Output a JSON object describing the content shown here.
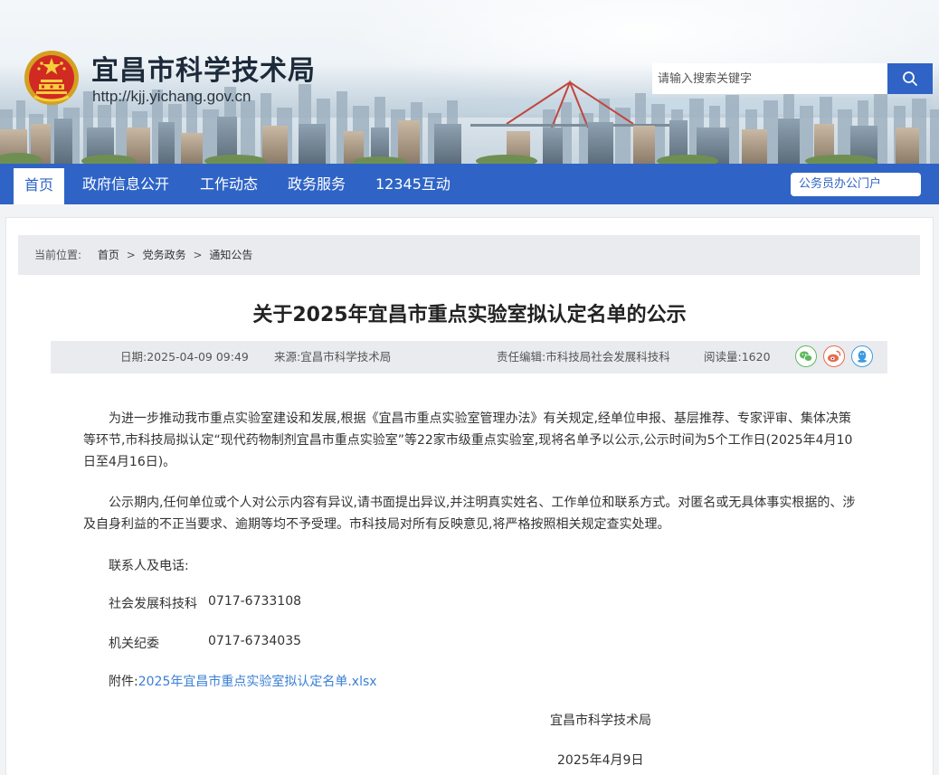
{
  "header": {
    "site_title": "宜昌市科学技术局",
    "site_url": "http://kjj.yichang.gov.cn",
    "search_placeholder": "请输入搜索关键字"
  },
  "nav": {
    "items": [
      "首页",
      "政府信息公开",
      "工作动态",
      "政务服务",
      "12345互动"
    ],
    "active": "首页",
    "portal_label": "公务员办公门户"
  },
  "breadcrumb": {
    "label": "当前位置:",
    "items": [
      "首页",
      "党务政务",
      "通知公告"
    ],
    "sep": ">"
  },
  "article": {
    "title": "关于2025年宜昌市重点实验室拟认定名单的公示",
    "meta": {
      "date": "日期:2025-04-09 09:49",
      "source": "来源:宜昌市科学技术局",
      "editor": "责任编辑:市科技局社会发展科技科",
      "views": "阅读量:1620"
    },
    "share_icons": [
      "wechat-icon",
      "weibo-icon",
      "qq-icon"
    ],
    "paragraphs": [
      "为进一步推动我市重点实验室建设和发展,根据《宜昌市重点实验室管理办法》有关规定,经单位申报、基层推荐、专家评审、集体决策等环节,市科技局拟认定“现代药物制剂宜昌市重点实验室”等22家市级重点实验室,现将名单予以公示,公示时间为5个工作日(2025年4月10日至4月16日)。",
      "公示期内,任何单位或个人对公示内容有异议,请书面提出异议,并注明真实姓名、工作单位和联系方式。对匿名或无具体事实根据的、涉及自身利益的不正当要求、逾期等均不予受理。市科技局对所有反映意见,将严格按照相关规定查实处理。"
    ],
    "contact_label": "联系人及电话:",
    "contacts": [
      {
        "name": "社会发展科技科",
        "phone": "0717-6733108"
      },
      {
        "name": "机关纪委",
        "phone": "0717-6734035"
      }
    ],
    "attachment_label": "附件:",
    "attachment_link": "2025年宜昌市重点实验室拟认定名单.xlsx",
    "signature": "宜昌市科学技术局",
    "sign_date": "2025年4月9日"
  }
}
